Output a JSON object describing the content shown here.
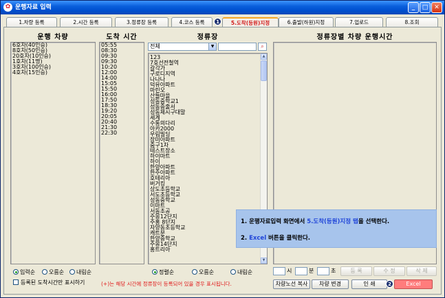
{
  "window": {
    "title": "운행자료 입력"
  },
  "tabs": [
    {
      "label": "1.차량 등록"
    },
    {
      "label": "2.시간 등록"
    },
    {
      "label": "3.정류장 등록"
    },
    {
      "label": "4.코스 등록"
    },
    {
      "label": "5.도착(등원)지정"
    },
    {
      "label": "6.출발(하원)지정"
    },
    {
      "label": "7.업로드"
    },
    {
      "label": "8.조회"
    }
  ],
  "active_tab": "5.도착(등원)지정",
  "headers": {
    "vehicles": "운행 차량",
    "arrival_time": "도착 시간",
    "stops": "정류장",
    "schedule": "정류장별 차량 운행시간"
  },
  "vehicles": [
    "6호차(40인승)",
    "8호차(50인승)",
    "20호차(10인승)",
    "1호차(11명)",
    "3호차(100인승)",
    "4호차(15인승)"
  ],
  "times": [
    "05:55",
    "08:30",
    "09:30",
    "09:30",
    "10:20",
    "12:00",
    "14:00",
    "15:05",
    "15:50",
    "16:00",
    "17:50",
    "18:30",
    "19:20",
    "20:05",
    "20:40",
    "21:30",
    "22:30"
  ],
  "stop_filter": {
    "selected": "전체",
    "search_value": ""
  },
  "stops": [
    "123",
    "7호선전철역",
    "갈각가",
    "구로디지역",
    "나나나",
    "덕유아파트",
    "마린오",
    "산들마을",
    "성동중학교1",
    "성동중출서",
    "성동체시구대말",
    "세계",
    "수통의다리",
    "아카2000",
    "우림빌딩",
    "장미아파트",
    "줌구1차",
    "테스트장소",
    "하이마트",
    "하이",
    "한양아파트",
    "한주아파트",
    "호테리아",
    "버거킹",
    "상도초등학교",
    "서도초등학교",
    "성동중학교",
    "이마트",
    "서동초공",
    "주몽12단지",
    "주홍 8단지",
    "자양동초등학교",
    "캐트분",
    "한양중학교",
    "주몽14단지",
    "홍트리아"
  ],
  "sort_left": {
    "options": [
      "입력순",
      "오름순",
      "내림순"
    ],
    "selected": "입력순"
  },
  "sort_mid": {
    "options": [
      "정렬순",
      "오름순",
      "내림순"
    ],
    "selected": "정렬순"
  },
  "checkbox_label": "등록된 도착시간만 표시하기",
  "checkbox_checked": false,
  "note": "(+)는 해당 시간에 정류장이 등록되어 있을 경우 표시됩니다.",
  "time_inputs": {
    "hour_label": "시",
    "minute_label": "분",
    "second_label": "초"
  },
  "buttons": {
    "register": "등 록",
    "edit": "수 정",
    "delete": "삭 제",
    "copy_route": "차량노선 복사",
    "change_vehicle": "차량 변경",
    "print": "인 쇄",
    "excel": "Excel"
  },
  "callout": {
    "line1_prefix": "1. 운행자료입력 화면에서 ",
    "line1_highlight": "5.도착(등원)지정 탭",
    "line1_suffix": "을 선택한다.",
    "line2_prefix": "2. ",
    "line2_highlight": "Excel",
    "line2_suffix": " 버튼을 클릭한다."
  },
  "badges": {
    "tab_badge": "1",
    "excel_badge": "2"
  },
  "colors": {
    "active_tab_text": "#d21818",
    "callout_bg": "#a7c4ec",
    "excel_bg": "#ff7c7c",
    "note_text": "#e01b1b"
  }
}
